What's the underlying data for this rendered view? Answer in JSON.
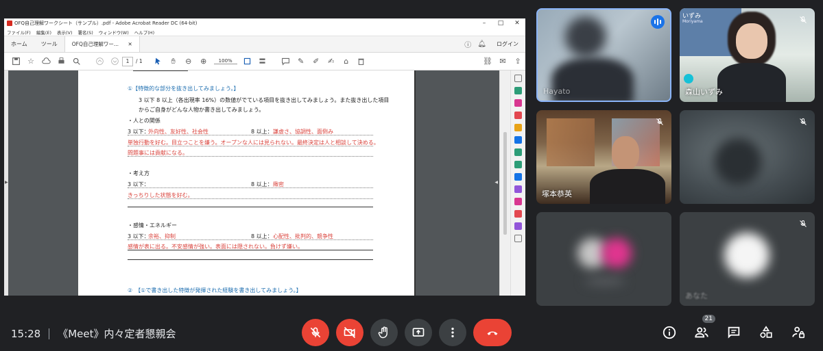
{
  "acrobat": {
    "window_title": "OFQ自己理解ワークシート（サンプル）.pdf - Adobe Acrobat Reader DC (64-bit)",
    "menu": [
      "ファイル(F)",
      "編集(E)",
      "表示(V)",
      "署名(S)",
      "ウィンドウ(W)",
      "ヘルプ(H)"
    ],
    "tabs": {
      "home": "ホーム",
      "tools": "ツール",
      "doc": "OFQ自己理解ワー..."
    },
    "login": "ログイン",
    "page_current": "1",
    "page_total": "/ 1",
    "zoom": "100%"
  },
  "document": {
    "heading1": "①【特徴的な部分を抜き出してみましょう。】",
    "intro1": "3 以下 8 以上（各出現率 16%）の数値がでている項目を抜き出してみましょう。また抜き出した項目",
    "intro2": "からご自身がどんな人物か書き出してみましょう。",
    "sec1": {
      "title": "・人との関係",
      "low_label": "3 以下：",
      "low_value": "外向性、友好性、社会性",
      "high_label": "8 以上：",
      "high_value": "謙虚さ、協調性、面倒み",
      "line1": "単独行動を好む。目立つことを嫌う。オープンな人には見られない。最終決定は人と相談して決める。",
      "line2": "問題事には貢献になる。"
    },
    "sec2": {
      "title": "・考え方",
      "low_label": "3 以下：",
      "high_label": "8 以上：",
      "high_value": "緻密",
      "line1": "きっちりした状態を好む。"
    },
    "sec3": {
      "title": "・感情・エネルギー",
      "low_label": "3 以下：",
      "low_value": "余裕、抑制",
      "high_label": "8 以上：",
      "high_value": "心配性、批判的、競争性",
      "line1": "感情が表に出る。不安感情が強い。表面には隠されない。負けず嫌い。"
    },
    "heading2": "②　【①で書き出した特徴が発揮された経験を書き出してみましょう。】"
  },
  "participants": [
    {
      "name": "Hayato",
      "state": "speaking"
    },
    {
      "name": "森山いずみ",
      "state": "muted",
      "overlay_top": "いずみ",
      "overlay_sub": "Moriyama"
    },
    {
      "name": "塚本恭英",
      "state": "muted"
    },
    {
      "name": "",
      "state": "muted"
    },
    {
      "name": "",
      "state": "camera-off"
    },
    {
      "name": "あなた",
      "state": "muted"
    }
  ],
  "meeting": {
    "time": "15:28",
    "title": "《Meet》内々定者懇親会",
    "participant_count": "21"
  },
  "colors": {
    "meet_bg": "#202124",
    "danger": "#ea4335",
    "speaking": "#1a73e8"
  }
}
